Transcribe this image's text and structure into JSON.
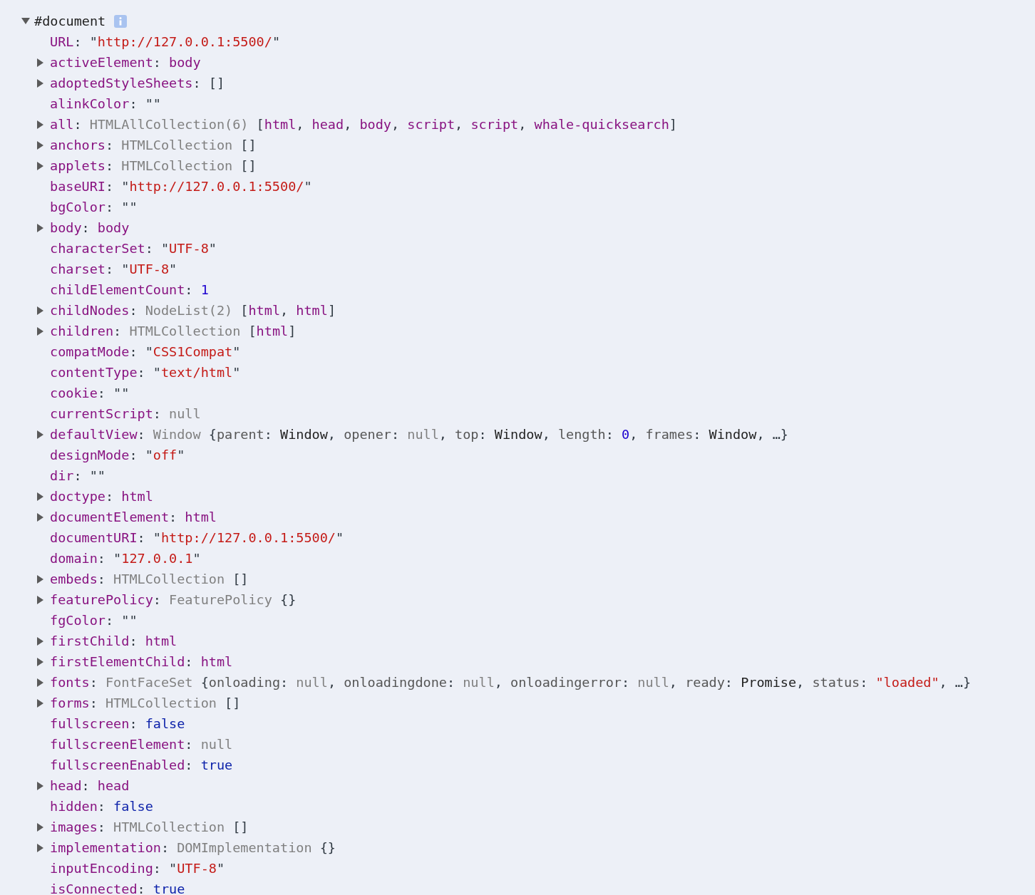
{
  "root": {
    "label": "#document",
    "expanded": true,
    "info": true
  },
  "properties": [
    {
      "key": "URL",
      "value": [
        {
          "text": ": ",
          "kind": "punct"
        },
        {
          "text": "\"",
          "kind": "punct"
        },
        {
          "text": "http://127.0.0.1:5500/",
          "kind": "string"
        },
        {
          "text": "\"",
          "kind": "punct"
        }
      ]
    },
    {
      "key": "activeElement",
      "expanded": false,
      "value": [
        {
          "text": ": ",
          "kind": "punct"
        },
        {
          "text": "body",
          "kind": "node"
        }
      ]
    },
    {
      "key": "adoptedStyleSheets",
      "expanded": false,
      "value": [
        {
          "text": ": ",
          "kind": "punct"
        },
        {
          "text": "[]",
          "kind": "punct"
        }
      ]
    },
    {
      "key": "alinkColor",
      "value": [
        {
          "text": ": ",
          "kind": "punct"
        },
        {
          "text": "\"\"",
          "kind": "punct"
        }
      ]
    },
    {
      "key": "all",
      "expanded": false,
      "value": [
        {
          "text": ": ",
          "kind": "punct"
        },
        {
          "text": "HTMLAllCollection(6) ",
          "kind": "type"
        },
        {
          "text": "[",
          "kind": "punct"
        },
        {
          "text": "html",
          "kind": "node"
        },
        {
          "text": ", ",
          "kind": "punct"
        },
        {
          "text": "head",
          "kind": "node"
        },
        {
          "text": ", ",
          "kind": "punct"
        },
        {
          "text": "body",
          "kind": "node"
        },
        {
          "text": ", ",
          "kind": "punct"
        },
        {
          "text": "script",
          "kind": "node"
        },
        {
          "text": ", ",
          "kind": "punct"
        },
        {
          "text": "script",
          "kind": "node"
        },
        {
          "text": ", ",
          "kind": "punct"
        },
        {
          "text": "whale-quicksearch",
          "kind": "node"
        },
        {
          "text": "]",
          "kind": "punct"
        }
      ]
    },
    {
      "key": "anchors",
      "expanded": false,
      "value": [
        {
          "text": ": ",
          "kind": "punct"
        },
        {
          "text": "HTMLCollection ",
          "kind": "type"
        },
        {
          "text": "[]",
          "kind": "punct"
        }
      ]
    },
    {
      "key": "applets",
      "expanded": false,
      "value": [
        {
          "text": ": ",
          "kind": "punct"
        },
        {
          "text": "HTMLCollection ",
          "kind": "type"
        },
        {
          "text": "[]",
          "kind": "punct"
        }
      ]
    },
    {
      "key": "baseURI",
      "value": [
        {
          "text": ": ",
          "kind": "punct"
        },
        {
          "text": "\"",
          "kind": "punct"
        },
        {
          "text": "http://127.0.0.1:5500/",
          "kind": "string"
        },
        {
          "text": "\"",
          "kind": "punct"
        }
      ]
    },
    {
      "key": "bgColor",
      "value": [
        {
          "text": ": ",
          "kind": "punct"
        },
        {
          "text": "\"\"",
          "kind": "punct"
        }
      ]
    },
    {
      "key": "body",
      "expanded": false,
      "value": [
        {
          "text": ": ",
          "kind": "punct"
        },
        {
          "text": "body",
          "kind": "node"
        }
      ]
    },
    {
      "key": "characterSet",
      "value": [
        {
          "text": ": ",
          "kind": "punct"
        },
        {
          "text": "\"",
          "kind": "punct"
        },
        {
          "text": "UTF-8",
          "kind": "string"
        },
        {
          "text": "\"",
          "kind": "punct"
        }
      ]
    },
    {
      "key": "charset",
      "value": [
        {
          "text": ": ",
          "kind": "punct"
        },
        {
          "text": "\"",
          "kind": "punct"
        },
        {
          "text": "UTF-8",
          "kind": "string"
        },
        {
          "text": "\"",
          "kind": "punct"
        }
      ]
    },
    {
      "key": "childElementCount",
      "value": [
        {
          "text": ": ",
          "kind": "punct"
        },
        {
          "text": "1",
          "kind": "number"
        }
      ]
    },
    {
      "key": "childNodes",
      "expanded": false,
      "value": [
        {
          "text": ": ",
          "kind": "punct"
        },
        {
          "text": "NodeList(2) ",
          "kind": "type"
        },
        {
          "text": "[",
          "kind": "punct"
        },
        {
          "text": "html",
          "kind": "node"
        },
        {
          "text": ", ",
          "kind": "punct"
        },
        {
          "text": "html",
          "kind": "node"
        },
        {
          "text": "]",
          "kind": "punct"
        }
      ]
    },
    {
      "key": "children",
      "expanded": false,
      "value": [
        {
          "text": ": ",
          "kind": "punct"
        },
        {
          "text": "HTMLCollection ",
          "kind": "type"
        },
        {
          "text": "[",
          "kind": "punct"
        },
        {
          "text": "html",
          "kind": "node"
        },
        {
          "text": "]",
          "kind": "punct"
        }
      ]
    },
    {
      "key": "compatMode",
      "value": [
        {
          "text": ": ",
          "kind": "punct"
        },
        {
          "text": "\"",
          "kind": "punct"
        },
        {
          "text": "CSS1Compat",
          "kind": "string"
        },
        {
          "text": "\"",
          "kind": "punct"
        }
      ]
    },
    {
      "key": "contentType",
      "value": [
        {
          "text": ": ",
          "kind": "punct"
        },
        {
          "text": "\"",
          "kind": "punct"
        },
        {
          "text": "text/html",
          "kind": "string"
        },
        {
          "text": "\"",
          "kind": "punct"
        }
      ]
    },
    {
      "key": "cookie",
      "value": [
        {
          "text": ": ",
          "kind": "punct"
        },
        {
          "text": "\"\"",
          "kind": "punct"
        }
      ]
    },
    {
      "key": "currentScript",
      "value": [
        {
          "text": ": ",
          "kind": "punct"
        },
        {
          "text": "null",
          "kind": "null"
        }
      ]
    },
    {
      "key": "defaultView",
      "expanded": false,
      "value": [
        {
          "text": ": ",
          "kind": "punct"
        },
        {
          "text": "Window ",
          "kind": "type"
        },
        {
          "text": "{",
          "kind": "punct"
        },
        {
          "text": "parent",
          "kind": "preview"
        },
        {
          "text": ": ",
          "kind": "punct"
        },
        {
          "text": "Window",
          "kind": "object"
        },
        {
          "text": ", ",
          "kind": "punct"
        },
        {
          "text": "opener",
          "kind": "preview"
        },
        {
          "text": ": ",
          "kind": "punct"
        },
        {
          "text": "null",
          "kind": "null"
        },
        {
          "text": ", ",
          "kind": "punct"
        },
        {
          "text": "top",
          "kind": "preview"
        },
        {
          "text": ": ",
          "kind": "punct"
        },
        {
          "text": "Window",
          "kind": "object"
        },
        {
          "text": ", ",
          "kind": "punct"
        },
        {
          "text": "length",
          "kind": "preview"
        },
        {
          "text": ": ",
          "kind": "punct"
        },
        {
          "text": "0",
          "kind": "number"
        },
        {
          "text": ", ",
          "kind": "punct"
        },
        {
          "text": "frames",
          "kind": "preview"
        },
        {
          "text": ": ",
          "kind": "punct"
        },
        {
          "text": "Window",
          "kind": "object"
        },
        {
          "text": ", …}",
          "kind": "punct"
        }
      ]
    },
    {
      "key": "designMode",
      "value": [
        {
          "text": ": ",
          "kind": "punct"
        },
        {
          "text": "\"",
          "kind": "punct"
        },
        {
          "text": "off",
          "kind": "string"
        },
        {
          "text": "\"",
          "kind": "punct"
        }
      ]
    },
    {
      "key": "dir",
      "value": [
        {
          "text": ": ",
          "kind": "punct"
        },
        {
          "text": "\"\"",
          "kind": "punct"
        }
      ]
    },
    {
      "key": "doctype",
      "expanded": false,
      "value": [
        {
          "text": ": ",
          "kind": "punct"
        },
        {
          "text": "html",
          "kind": "node"
        }
      ]
    },
    {
      "key": "documentElement",
      "expanded": false,
      "value": [
        {
          "text": ": ",
          "kind": "punct"
        },
        {
          "text": "html",
          "kind": "node"
        }
      ]
    },
    {
      "key": "documentURI",
      "value": [
        {
          "text": ": ",
          "kind": "punct"
        },
        {
          "text": "\"",
          "kind": "punct"
        },
        {
          "text": "http://127.0.0.1:5500/",
          "kind": "string"
        },
        {
          "text": "\"",
          "kind": "punct"
        }
      ]
    },
    {
      "key": "domain",
      "value": [
        {
          "text": ": ",
          "kind": "punct"
        },
        {
          "text": "\"",
          "kind": "punct"
        },
        {
          "text": "127.0.0.1",
          "kind": "string"
        },
        {
          "text": "\"",
          "kind": "punct"
        }
      ]
    },
    {
      "key": "embeds",
      "expanded": false,
      "value": [
        {
          "text": ": ",
          "kind": "punct"
        },
        {
          "text": "HTMLCollection ",
          "kind": "type"
        },
        {
          "text": "[]",
          "kind": "punct"
        }
      ]
    },
    {
      "key": "featurePolicy",
      "expanded": false,
      "value": [
        {
          "text": ": ",
          "kind": "punct"
        },
        {
          "text": "FeaturePolicy ",
          "kind": "type"
        },
        {
          "text": "{}",
          "kind": "punct"
        }
      ]
    },
    {
      "key": "fgColor",
      "value": [
        {
          "text": ": ",
          "kind": "punct"
        },
        {
          "text": "\"\"",
          "kind": "punct"
        }
      ]
    },
    {
      "key": "firstChild",
      "expanded": false,
      "value": [
        {
          "text": ": ",
          "kind": "punct"
        },
        {
          "text": "html",
          "kind": "node"
        }
      ]
    },
    {
      "key": "firstElementChild",
      "expanded": false,
      "value": [
        {
          "text": ": ",
          "kind": "punct"
        },
        {
          "text": "html",
          "kind": "node"
        }
      ]
    },
    {
      "key": "fonts",
      "expanded": false,
      "value": [
        {
          "text": ": ",
          "kind": "punct"
        },
        {
          "text": "FontFaceSet ",
          "kind": "type"
        },
        {
          "text": "{",
          "kind": "punct"
        },
        {
          "text": "onloading",
          "kind": "preview"
        },
        {
          "text": ": ",
          "kind": "punct"
        },
        {
          "text": "null",
          "kind": "null"
        },
        {
          "text": ", ",
          "kind": "punct"
        },
        {
          "text": "onloadingdone",
          "kind": "preview"
        },
        {
          "text": ": ",
          "kind": "punct"
        },
        {
          "text": "null",
          "kind": "null"
        },
        {
          "text": ", ",
          "kind": "punct"
        },
        {
          "text": "onloadingerror",
          "kind": "preview"
        },
        {
          "text": ": ",
          "kind": "punct"
        },
        {
          "text": "null",
          "kind": "null"
        },
        {
          "text": ", ",
          "kind": "punct"
        },
        {
          "text": "ready",
          "kind": "preview"
        },
        {
          "text": ": ",
          "kind": "punct"
        },
        {
          "text": "Promise",
          "kind": "object"
        },
        {
          "text": ", ",
          "kind": "punct"
        },
        {
          "text": "status",
          "kind": "preview"
        },
        {
          "text": ": ",
          "kind": "punct"
        },
        {
          "text": "\"loaded\"",
          "kind": "string"
        },
        {
          "text": ", …}",
          "kind": "punct"
        }
      ]
    },
    {
      "key": "forms",
      "expanded": false,
      "value": [
        {
          "text": ": ",
          "kind": "punct"
        },
        {
          "text": "HTMLCollection ",
          "kind": "type"
        },
        {
          "text": "[]",
          "kind": "punct"
        }
      ]
    },
    {
      "key": "fullscreen",
      "value": [
        {
          "text": ": ",
          "kind": "punct"
        },
        {
          "text": "false",
          "kind": "boolean"
        }
      ]
    },
    {
      "key": "fullscreenElement",
      "value": [
        {
          "text": ": ",
          "kind": "punct"
        },
        {
          "text": "null",
          "kind": "null"
        }
      ]
    },
    {
      "key": "fullscreenEnabled",
      "value": [
        {
          "text": ": ",
          "kind": "punct"
        },
        {
          "text": "true",
          "kind": "boolean"
        }
      ]
    },
    {
      "key": "head",
      "expanded": false,
      "value": [
        {
          "text": ": ",
          "kind": "punct"
        },
        {
          "text": "head",
          "kind": "node"
        }
      ]
    },
    {
      "key": "hidden",
      "value": [
        {
          "text": ": ",
          "kind": "punct"
        },
        {
          "text": "false",
          "kind": "boolean"
        }
      ]
    },
    {
      "key": "images",
      "expanded": false,
      "value": [
        {
          "text": ": ",
          "kind": "punct"
        },
        {
          "text": "HTMLCollection ",
          "kind": "type"
        },
        {
          "text": "[]",
          "kind": "punct"
        }
      ]
    },
    {
      "key": "implementation",
      "expanded": false,
      "value": [
        {
          "text": ": ",
          "kind": "punct"
        },
        {
          "text": "DOMImplementation ",
          "kind": "type"
        },
        {
          "text": "{}",
          "kind": "punct"
        }
      ]
    },
    {
      "key": "inputEncoding",
      "value": [
        {
          "text": ": ",
          "kind": "punct"
        },
        {
          "text": "\"",
          "kind": "punct"
        },
        {
          "text": "UTF-8",
          "kind": "string"
        },
        {
          "text": "\"",
          "kind": "punct"
        }
      ]
    },
    {
      "key": "isConnected",
      "value": [
        {
          "text": ": ",
          "kind": "punct"
        },
        {
          "text": "true",
          "kind": "boolean"
        }
      ]
    }
  ]
}
